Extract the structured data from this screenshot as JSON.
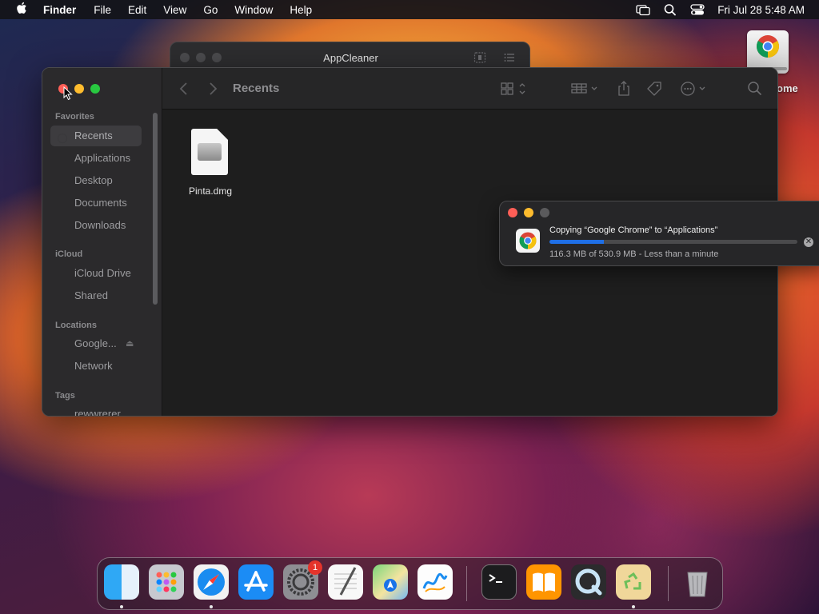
{
  "menubar": {
    "app_name": "Finder",
    "menus": [
      "File",
      "Edit",
      "View",
      "Go",
      "Window",
      "Help"
    ],
    "clock": "Fri Jul 28  5:48 AM"
  },
  "desktop": {
    "icon_label": "rome"
  },
  "appcleaner": {
    "title": "AppCleaner"
  },
  "finder": {
    "toolbar_title": "Recents",
    "sidebar": {
      "favorites_label": "Favorites",
      "favorites": [
        "Recents",
        "Applications",
        "Desktop",
        "Documents",
        "Downloads"
      ],
      "icloud_label": "iCloud",
      "icloud": [
        "iCloud Drive",
        "Shared"
      ],
      "locations_label": "Locations",
      "locations": [
        "Google...",
        "Network"
      ],
      "tags_label": "Tags",
      "tags": [
        "rewwrerer"
      ]
    },
    "files": [
      {
        "name": "Pinta.dmg"
      }
    ]
  },
  "copy_dialog": {
    "message": "Copying “Google Chrome” to “Applications”",
    "status": "116.3 MB of 530.9 MB - Less than a minute",
    "progress": 0.22
  },
  "dock": {
    "apps": [
      "Finder",
      "Launchpad",
      "Safari",
      "App Store",
      "System Settings",
      "TextEdit",
      "Maps",
      "Freeform",
      "Terminal",
      "Books",
      "QuickTime Player",
      "AppCleaner",
      "Trash"
    ],
    "settings_badge": "1"
  },
  "colors": {
    "accent": "#1f6fe6",
    "close": "#ff5f57",
    "minimize": "#febc2e",
    "zoom": "#28c840"
  }
}
